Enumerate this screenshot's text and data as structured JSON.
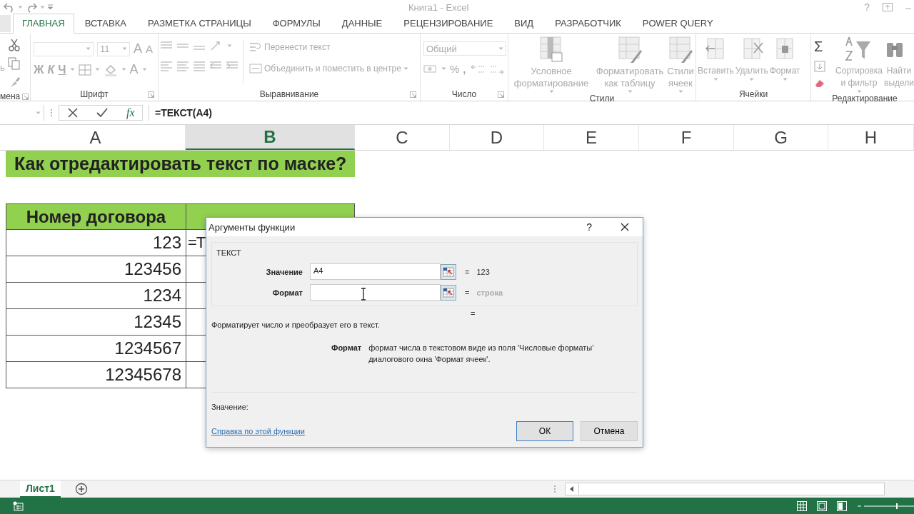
{
  "window": {
    "title": "Книга1 - Excel",
    "help": "?"
  },
  "tabs": [
    {
      "label": "ГЛАВНАЯ",
      "selected": true
    },
    {
      "label": "ВСТАВКА",
      "selected": false
    },
    {
      "label": "РАЗМЕТКА СТРАНИЦЫ",
      "selected": false
    },
    {
      "label": "ФОРМУЛЫ",
      "selected": false
    },
    {
      "label": "ДАННЫЕ",
      "selected": false
    },
    {
      "label": "РЕЦЕНЗИРОВАНИЕ",
      "selected": false
    },
    {
      "label": "ВИД",
      "selected": false
    },
    {
      "label": "РАЗРАБОТЧИК",
      "selected": false
    },
    {
      "label": "POWER QUERY",
      "selected": false
    }
  ],
  "ribbon": {
    "groups": [
      {
        "kind": "clipboard",
        "label": "мена",
        "paste_label": "ь"
      },
      {
        "kind": "font",
        "label": "Шрифт",
        "size": "11",
        "resize_letters": [
          "A",
          "A"
        ],
        "styles": [
          "Ж",
          "К",
          "Ч"
        ],
        "color_letter": "A"
      },
      {
        "kind": "alignment",
        "label": "Выравнивание",
        "buttons": [
          "Перенести текст",
          "Объединить и поместить в центре"
        ]
      },
      {
        "kind": "number",
        "label": "Число",
        "format": "Общий",
        "symbols": [
          "%",
          ","
        ]
      },
      {
        "kind": "styles",
        "label": "Стили",
        "buttons": [
          "Условное\nформатирование",
          "Форматировать\nкак таблицу",
          "Стили\nячеек"
        ]
      },
      {
        "kind": "cells",
        "label": "Ячейки",
        "buttons": [
          "Вставить",
          "Удалить",
          "Формат"
        ]
      },
      {
        "kind": "editing",
        "label": "Редактирование",
        "sum": "Σ",
        "buttons": [
          "Сортировка\nи фильтр",
          "Найти\nвыдели"
        ]
      }
    ]
  },
  "formula_bar": {
    "function_button": "fx",
    "formula": "=ТЕКСТ(A4)"
  },
  "sheet": {
    "columns": [
      {
        "label": "A",
        "selected": false
      },
      {
        "label": "B",
        "selected": true
      },
      {
        "label": "C",
        "selected": false
      },
      {
        "label": "D",
        "selected": false
      },
      {
        "label": "E",
        "selected": false
      },
      {
        "label": "F",
        "selected": false
      },
      {
        "label": "G",
        "selected": false
      },
      {
        "label": "H",
        "selected": false
      }
    ],
    "rows": [
      {
        "kind": "title",
        "cells": [
          "Как отредактировать текст по маске?"
        ]
      },
      {
        "kind": "empty"
      },
      {
        "kind": "header",
        "cells": [
          "Номер договора"
        ]
      },
      {
        "kind": "data",
        "cells": [
          "123",
          "=Т"
        ]
      },
      {
        "kind": "data",
        "cells": [
          "123456"
        ]
      },
      {
        "kind": "data",
        "cells": [
          "1234"
        ]
      },
      {
        "kind": "data",
        "cells": [
          "12345"
        ]
      },
      {
        "kind": "data",
        "cells": [
          "1234567"
        ]
      },
      {
        "kind": "data",
        "cells": [
          "12345678"
        ]
      }
    ]
  },
  "sheet_tabs": [
    {
      "label": "Лист1",
      "selected": true
    }
  ],
  "dialog": {
    "title": "Аргументы функции",
    "help": "?",
    "function_name": "ТЕКСТ",
    "arguments": [
      {
        "label": "Значение",
        "value": "A4",
        "equals": "=",
        "result": "123",
        "result_dimmed": false
      },
      {
        "label": "Формат",
        "equals": "=",
        "result": "строка",
        "result_dimmed": true
      }
    ],
    "formula_result": "=",
    "description": "Форматирует число и преобразует его в текст.",
    "argument_help": {
      "name": "Формат",
      "text": "формат числа в текстовом виде из поля 'Числовые форматы' диалогового окна 'Формат ячеек'."
    },
    "value_label": "Значение:",
    "help_link": "Справка по этой функции",
    "buttons": [
      {
        "label": "ОК",
        "default": true
      },
      {
        "label": "Отмена",
        "default": false
      }
    ]
  }
}
